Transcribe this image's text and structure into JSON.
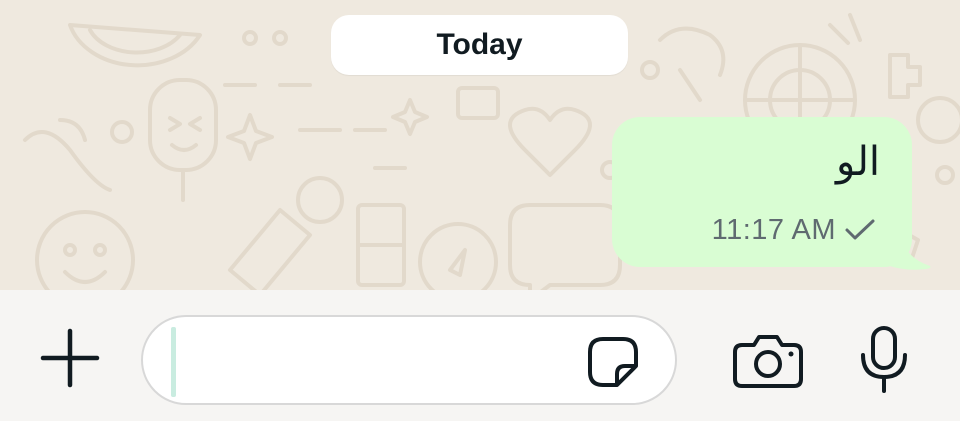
{
  "chat": {
    "date_divider": "Today",
    "messages": [
      {
        "text": "الو",
        "time": "11:17 AM",
        "status_icon": "single-check-icon",
        "direction": "outgoing"
      }
    ]
  },
  "composer": {
    "input_value": "",
    "icons": [
      "plus-icon",
      "sticker-icon",
      "camera-icon",
      "microphone-icon"
    ]
  },
  "colors": {
    "wallpaper": "#efe9df",
    "outgoing_bubble": "#d9fdd3",
    "date_pill": "#ffffff",
    "composer_bar": "#f6f5f3",
    "caret": "#c9ece0"
  }
}
